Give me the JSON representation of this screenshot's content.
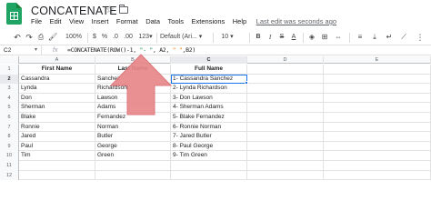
{
  "app": {
    "title": "CONCATENATE",
    "star_icon": "star-outline-icon",
    "folder_icon": "move-folder-icon",
    "logo_icon": "sheets-logo-icon"
  },
  "menu": {
    "items": [
      "File",
      "Edit",
      "View",
      "Insert",
      "Format",
      "Data",
      "Tools",
      "Extensions",
      "Help"
    ],
    "last_edit": "Last edit was seconds ago"
  },
  "toolbar": {
    "undo_icon": "undo-icon",
    "redo_icon": "redo-icon",
    "print_icon": "print-icon",
    "paint_format_icon": "paint-format-icon",
    "zoom": "100%",
    "currency": "$",
    "percent": "%",
    "decrease_decimal": ".0",
    "increase_decimal": ".00",
    "more_formats": "123",
    "font": "Default (Ari...",
    "font_size": "10",
    "bold": "B",
    "italic": "I",
    "strikethrough": "S",
    "text_color": "A"
  },
  "formula_bar": {
    "cell_ref": "C2",
    "fx": "fx",
    "formula_prefix": "=CONCATENATE(ROW()-1, ",
    "formula_string1": "\"- \"",
    "formula_mid": ", A2, ",
    "formula_string2": "\" \"",
    "formula_end": ",B2)"
  },
  "columns": [
    "A",
    "B",
    "C",
    "D",
    "E"
  ],
  "table": {
    "headers": [
      "First Name",
      "Last Name",
      "Full Name"
    ],
    "rows": [
      {
        "num": "2",
        "first": "Cassandra",
        "last": "Sanchez",
        "full": "1- Cassandra Sanchez"
      },
      {
        "num": "3",
        "first": "Lynda",
        "last": "Richardson",
        "full": "2- Lynda Richardson"
      },
      {
        "num": "4",
        "first": "Don",
        "last": "Lawson",
        "full": "3- Don Lawson"
      },
      {
        "num": "5",
        "first": "Sherman",
        "last": "Adams",
        "full": "4- Sherman Adams"
      },
      {
        "num": "6",
        "first": "Blake",
        "last": "Fernandez",
        "full": "5- Blake Fernandez"
      },
      {
        "num": "7",
        "first": "Ronnie",
        "last": "Norman",
        "full": "6- Ronnie Norman"
      },
      {
        "num": "8",
        "first": "Jared",
        "last": "Butler",
        "full": "7- Jared Butler"
      },
      {
        "num": "9",
        "first": "Paul",
        "last": "George",
        "full": "8- Paul George"
      },
      {
        "num": "10",
        "first": "Tim",
        "last": "Green",
        "full": "9- Tim Green"
      }
    ],
    "extra_rows": [
      "11",
      "12"
    ]
  },
  "header_row_num": "1",
  "colors": {
    "accent": "#1a73e8",
    "arrow": "#e8878a",
    "sheets_green": "#1fa463"
  }
}
